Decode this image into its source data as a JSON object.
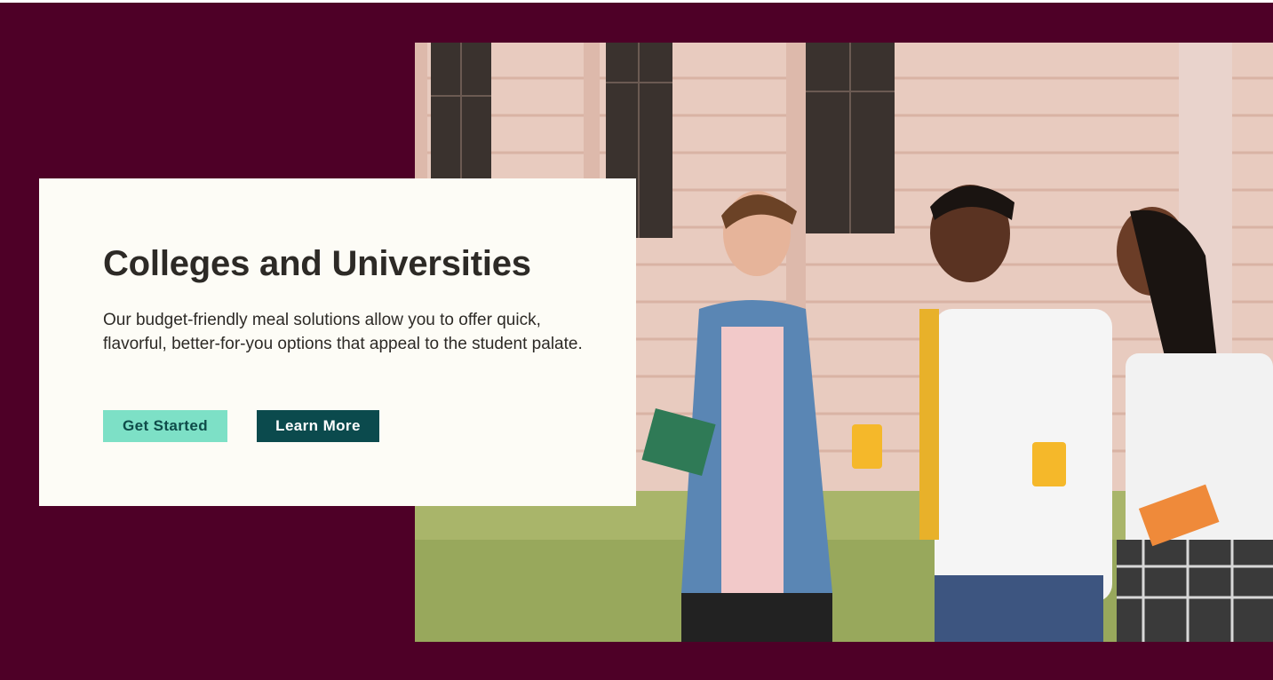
{
  "hero": {
    "title": "Colleges and Universities",
    "description": "Our budget-friendly meal solutions allow you to offer quick, flavorful, better-for-you options that appeal to the student palate.",
    "primary_button_label": "Get Started",
    "secondary_button_label": "Learn More",
    "image_alt": "Three students walking on campus lawn with juice and sandwiches"
  },
  "colors": {
    "background": "#4e0027",
    "card": "#fdfcf6",
    "primary_button": "#7de0c6",
    "secondary_button": "#0b4a4d",
    "text": "#2d2a26"
  }
}
